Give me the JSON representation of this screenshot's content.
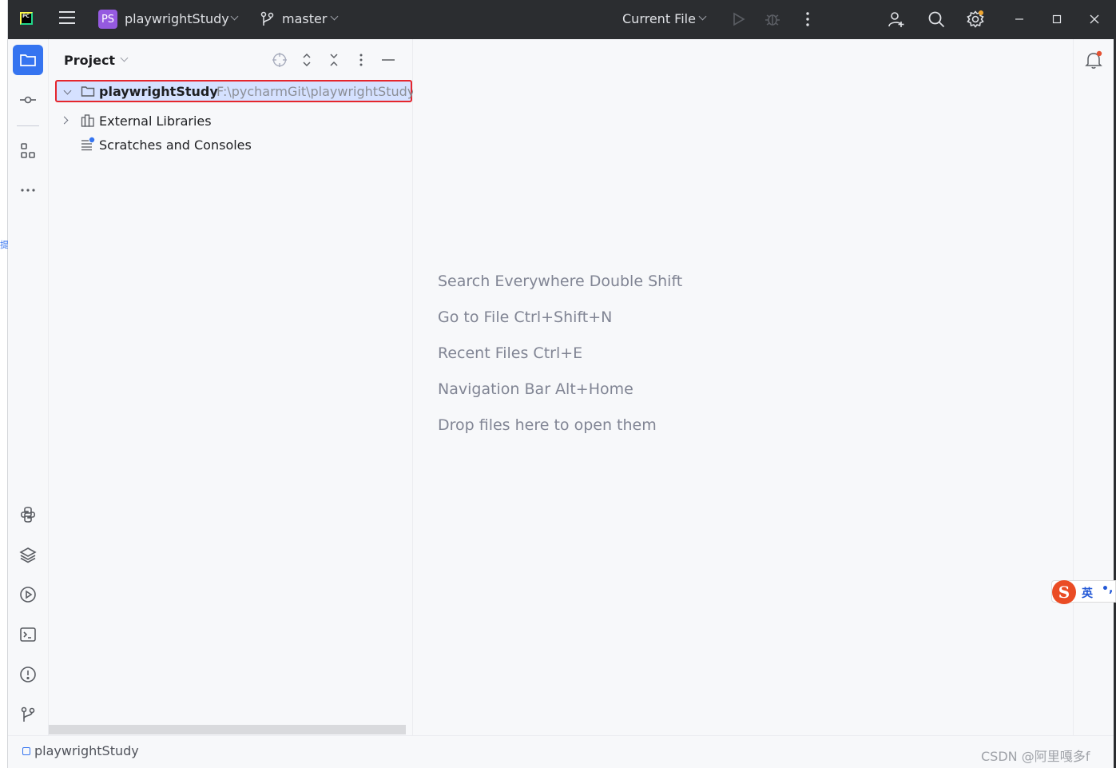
{
  "titlebar": {
    "logo_text": "PC",
    "project_badge": "PS",
    "project_name": "playwrightStudy",
    "branch": "master",
    "run_config": "Current File"
  },
  "tool_window": {
    "title": "Project"
  },
  "tree": {
    "root_name": "playwrightStudy",
    "root_path": "F:\\pycharmGit\\playwrightStudy",
    "external_libraries": "External Libraries",
    "scratches": "Scratches and Consoles"
  },
  "editor_hints": {
    "search": "Search Everywhere Double Shift",
    "goto_file": "Go to File Ctrl+Shift+N",
    "recent": "Recent Files Ctrl+E",
    "nav_bar": "Navigation Bar Alt+Home",
    "drop": "Drop files here to open them"
  },
  "ime": {
    "logo": "S",
    "mode": "英",
    "punct": "•,"
  },
  "statusbar": {
    "project": "playwrightStudy",
    "watermark": "CSDN @阿里嘎多f"
  },
  "colors": {
    "titlebar_bg": "#2b2d30",
    "accent": "#3574f0",
    "selection_bg": "#d5e1ff",
    "highlight_border": "#e5262d",
    "project_badge": "#955ae0",
    "notification_dot": "#e55233",
    "settings_dot": "#f0a732"
  }
}
